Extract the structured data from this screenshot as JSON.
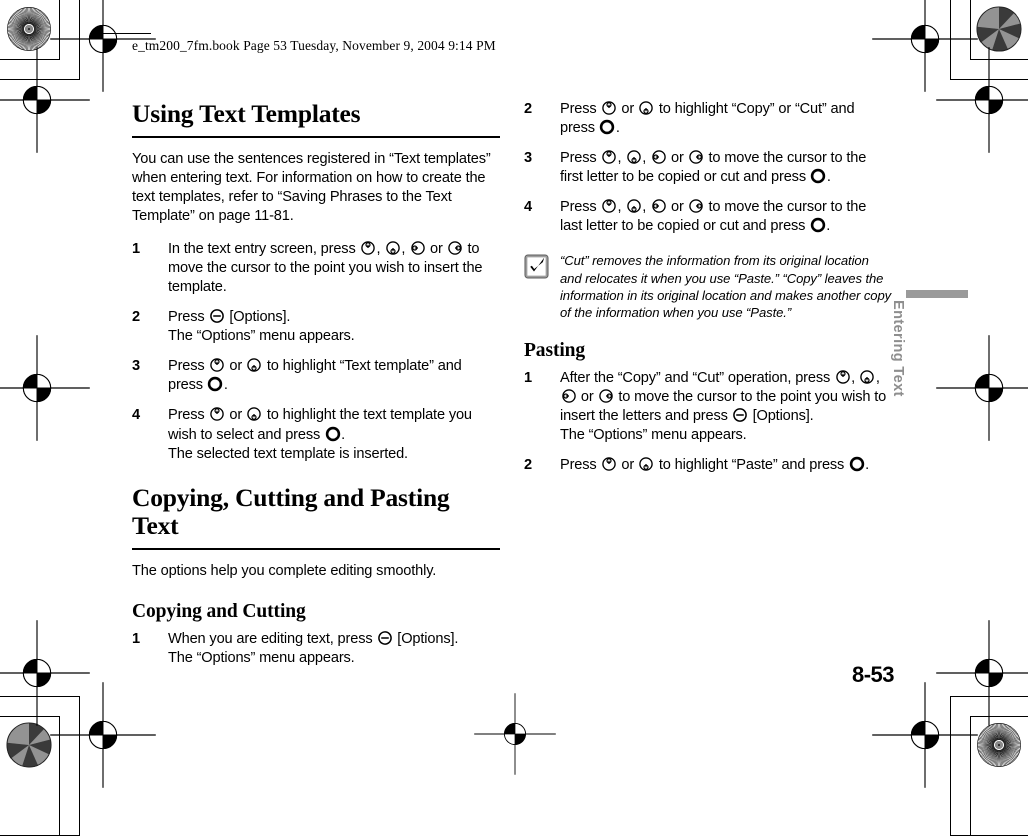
{
  "print_header": {
    "text": "e_tm200_7fm.book  Page 53  Tuesday, November 9, 2004  9:14 PM"
  },
  "side_tab": {
    "label": "Entering Text"
  },
  "page_number": "8-53",
  "left_column": {
    "heading": "Using Text Templates",
    "intro": "You can use the sentences registered in “Text templates” when entering text. For information on how to create the text templates, refer to “Saving Phrases to the Text Template” on page 11-81.",
    "steps": [
      {
        "num": "1",
        "parts": [
          {
            "t": "text",
            "v": "In the text entry screen, press "
          },
          {
            "t": "key",
            "v": "key-up"
          },
          {
            "t": "text",
            "v": ", "
          },
          {
            "t": "key",
            "v": "key-down"
          },
          {
            "t": "text",
            "v": ", "
          },
          {
            "t": "key",
            "v": "key-left"
          },
          {
            "t": "text",
            "v": " or "
          },
          {
            "t": "key",
            "v": "key-right"
          },
          {
            "t": "text",
            "v": " to move the cursor to the point you wish to insert the template."
          }
        ]
      },
      {
        "num": "2",
        "parts": [
          {
            "t": "text",
            "v": "Press "
          },
          {
            "t": "key",
            "v": "key-softkey"
          },
          {
            "t": "text",
            "v": " [Options]."
          }
        ],
        "result": "The “Options” menu appears."
      },
      {
        "num": "3",
        "parts": [
          {
            "t": "text",
            "v": "Press "
          },
          {
            "t": "key",
            "v": "key-up"
          },
          {
            "t": "text",
            "v": " or "
          },
          {
            "t": "key",
            "v": "key-down"
          },
          {
            "t": "text",
            "v": " to highlight “Text template” and press "
          },
          {
            "t": "key",
            "v": "key-center"
          },
          {
            "t": "text",
            "v": "."
          }
        ]
      },
      {
        "num": "4",
        "parts": [
          {
            "t": "text",
            "v": "Press "
          },
          {
            "t": "key",
            "v": "key-up"
          },
          {
            "t": "text",
            "v": " or "
          },
          {
            "t": "key",
            "v": "key-down"
          },
          {
            "t": "text",
            "v": " to highlight the text template you wish to select and press "
          },
          {
            "t": "key",
            "v": "key-center"
          },
          {
            "t": "text",
            "v": "."
          }
        ],
        "result": "The selected text template is inserted."
      }
    ],
    "heading2": "Copying, Cutting and Pasting Text",
    "intro2": "The options help you complete editing smoothly.",
    "subheading": "Copying and Cutting",
    "steps2": [
      {
        "num": "1",
        "parts": [
          {
            "t": "text",
            "v": "When you are editing text, press "
          },
          {
            "t": "key",
            "v": "key-softkey"
          },
          {
            "t": "text",
            "v": " [Options]."
          }
        ],
        "result": "The “Options” menu appears."
      }
    ]
  },
  "right_column": {
    "steps": [
      {
        "num": "2",
        "parts": [
          {
            "t": "text",
            "v": "Press "
          },
          {
            "t": "key",
            "v": "key-up"
          },
          {
            "t": "text",
            "v": " or "
          },
          {
            "t": "key",
            "v": "key-down"
          },
          {
            "t": "text",
            "v": " to highlight “Copy” or “Cut” and press "
          },
          {
            "t": "key",
            "v": "key-center"
          },
          {
            "t": "text",
            "v": "."
          }
        ]
      },
      {
        "num": "3",
        "parts": [
          {
            "t": "text",
            "v": "Press "
          },
          {
            "t": "key",
            "v": "key-up"
          },
          {
            "t": "text",
            "v": ", "
          },
          {
            "t": "key",
            "v": "key-down"
          },
          {
            "t": "text",
            "v": ", "
          },
          {
            "t": "key",
            "v": "key-left"
          },
          {
            "t": "text",
            "v": " or "
          },
          {
            "t": "key",
            "v": "key-right"
          },
          {
            "t": "text",
            "v": " to move the cursor to the first letter to be copied or cut and press "
          },
          {
            "t": "key",
            "v": "key-center"
          },
          {
            "t": "text",
            "v": "."
          }
        ]
      },
      {
        "num": "4",
        "parts": [
          {
            "t": "text",
            "v": "Press "
          },
          {
            "t": "key",
            "v": "key-up"
          },
          {
            "t": "text",
            "v": ", "
          },
          {
            "t": "key",
            "v": "key-down"
          },
          {
            "t": "text",
            "v": ", "
          },
          {
            "t": "key",
            "v": "key-left"
          },
          {
            "t": "text",
            "v": " or "
          },
          {
            "t": "key",
            "v": "key-right"
          },
          {
            "t": "text",
            "v": " to move the cursor to the last letter to be copied or cut and press "
          },
          {
            "t": "key",
            "v": "key-center"
          },
          {
            "t": "text",
            "v": "."
          }
        ]
      }
    ],
    "note": {
      "icon": "check-note-icon",
      "text": "“Cut” removes the information from its original location and relocates it when you use “Paste.” “Copy” leaves the information in its original location and makes another copy of the information when you use “Paste.”"
    },
    "subheading": "Pasting",
    "steps2": [
      {
        "num": "1",
        "parts": [
          {
            "t": "text",
            "v": "After the “Copy” and “Cut” operation, press "
          },
          {
            "t": "key",
            "v": "key-up"
          },
          {
            "t": "text",
            "v": ", "
          },
          {
            "t": "key",
            "v": "key-down"
          },
          {
            "t": "text",
            "v": ", "
          },
          {
            "t": "key",
            "v": "key-left"
          },
          {
            "t": "text",
            "v": " or "
          },
          {
            "t": "key",
            "v": "key-right"
          },
          {
            "t": "text",
            "v": " to move the cursor to the point you wish to insert the letters and press "
          },
          {
            "t": "key",
            "v": "key-softkey"
          },
          {
            "t": "text",
            "v": " [Options]."
          }
        ],
        "result": "The “Options” menu appears."
      },
      {
        "num": "2",
        "parts": [
          {
            "t": "text",
            "v": "Press "
          },
          {
            "t": "key",
            "v": "key-up"
          },
          {
            "t": "text",
            "v": " or "
          },
          {
            "t": "key",
            "v": "key-down"
          },
          {
            "t": "text",
            "v": " to highlight “Paste” and press "
          },
          {
            "t": "key",
            "v": "key-center"
          },
          {
            "t": "text",
            "v": "."
          }
        ]
      }
    ]
  },
  "printer_marks": {
    "registration_targets": 10,
    "resolution_targets": [
      "starburst-target",
      "pinwheel-target",
      "pinwheel-target",
      "starburst-target"
    ]
  }
}
